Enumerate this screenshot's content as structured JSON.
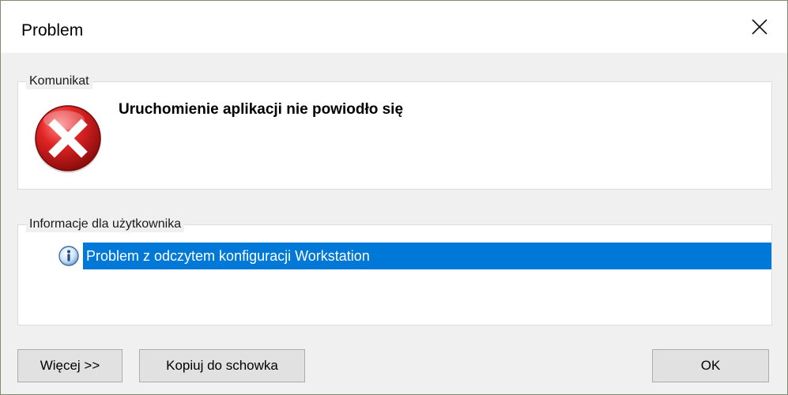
{
  "window": {
    "title": "Problem"
  },
  "message_group": {
    "legend": "Komunikat",
    "text": "Uruchomienie aplikacji nie powiodło się"
  },
  "info_group": {
    "legend": "Informacje dla użytkownika",
    "items": [
      {
        "text": "Problem z odczytem konfiguracji Workstation",
        "selected": true
      }
    ]
  },
  "buttons": {
    "more": "Więcej >>",
    "copy": "Kopiuj do schowka",
    "ok": "OK"
  },
  "icons": {
    "close": "close-icon",
    "error": "error-icon",
    "info": "info-icon"
  },
  "colors": {
    "selection": "#0078d7",
    "error_red": "#d32020",
    "dialog_bg": "#f0f0f0"
  }
}
